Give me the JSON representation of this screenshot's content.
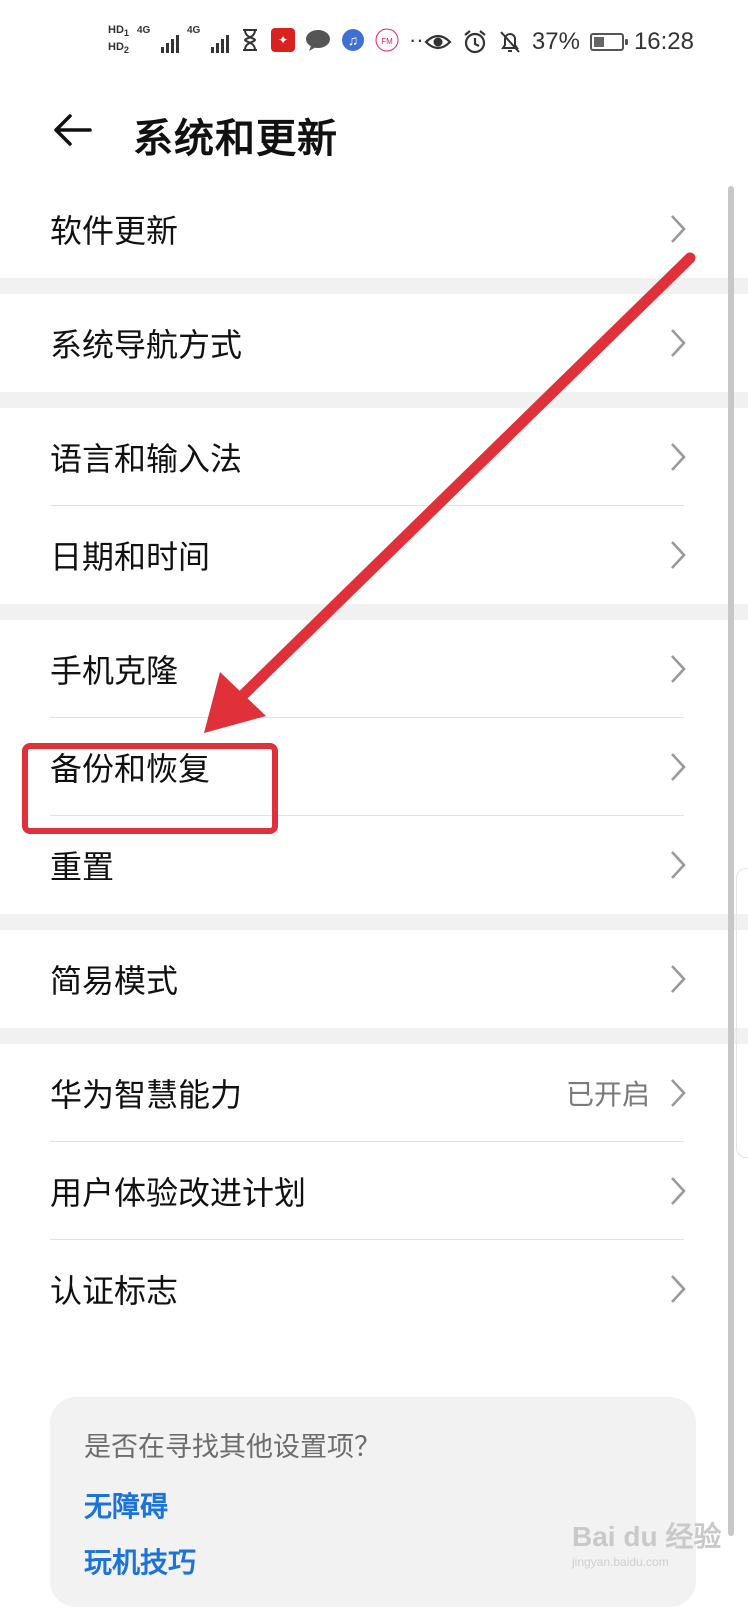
{
  "status_bar": {
    "hd1": "HD",
    "hd1_index": "1",
    "hd2": "HD",
    "hd2_index": "2",
    "net1": "4G",
    "net2": "4G",
    "more": "···",
    "battery_percent": "37%",
    "battery_level": 0.37,
    "time": "16:28",
    "icons": [
      "hourglass-icon",
      "app-icon",
      "message-icon",
      "music-icon",
      "fm-icon",
      "eye-icon",
      "alarm-icon",
      "bell-off-icon",
      "battery-icon"
    ]
  },
  "header": {
    "title": "系统和更新"
  },
  "list": {
    "items": [
      {
        "label": "软件更新"
      },
      {
        "label": "系统导航方式"
      },
      {
        "label": "语言和输入法"
      },
      {
        "label": "日期和时间"
      },
      {
        "label": "手机克隆"
      },
      {
        "label": "备份和恢复"
      },
      {
        "label": "重置"
      },
      {
        "label": "简易模式"
      },
      {
        "label": "华为智慧能力",
        "value": "已开启"
      },
      {
        "label": "用户体验改进计划"
      },
      {
        "label": "认证标志"
      }
    ]
  },
  "suggestion": {
    "question": "是否在寻找其他设置项？",
    "links": [
      "无障碍",
      "玩机技巧"
    ]
  },
  "watermark": {
    "brand": "Bai du 经验",
    "sub": "jingyan.baidu.com"
  },
  "colors": {
    "accent_link": "#1c73d8",
    "annotation": "#e0303a",
    "section_gap": "#f1f1f1"
  }
}
